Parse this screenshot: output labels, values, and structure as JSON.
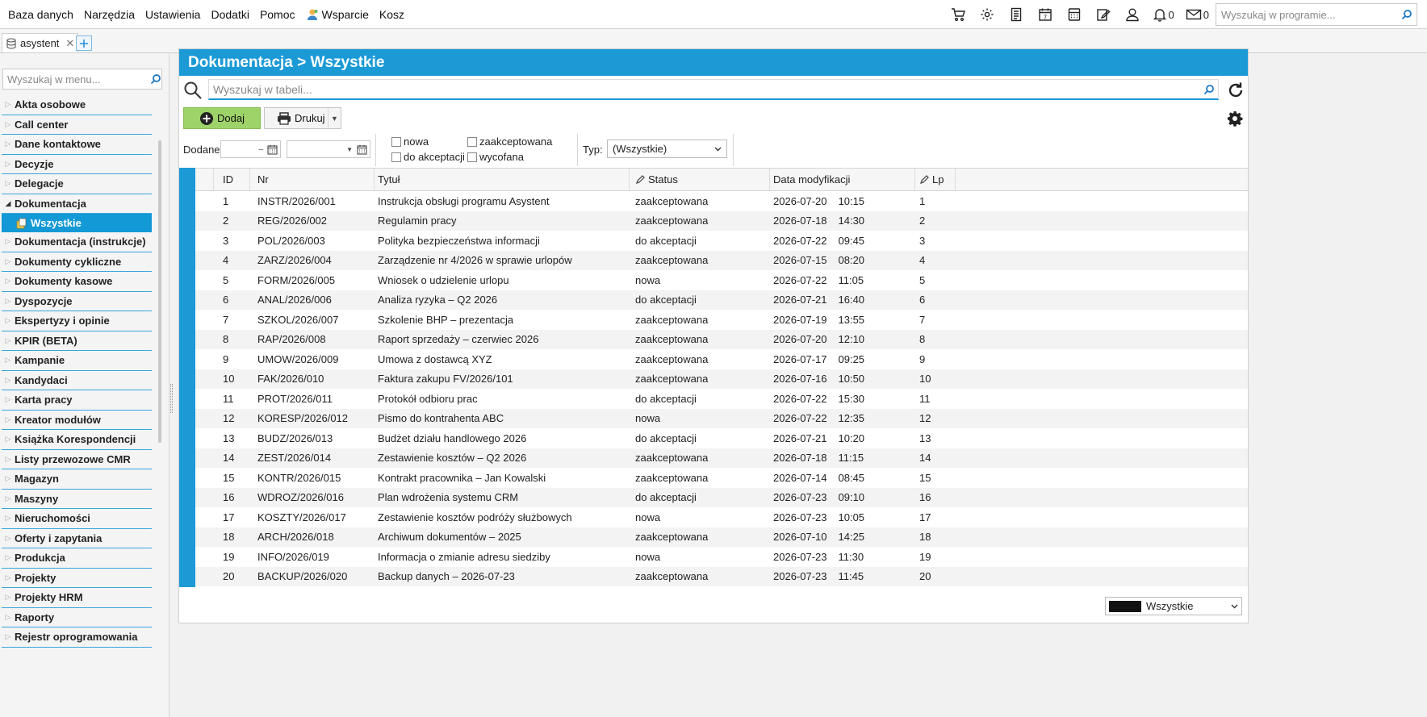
{
  "menu": {
    "items": [
      "Baza danych",
      "Narzędzia",
      "Ustawienia",
      "Dodatki",
      "Pomoc"
    ],
    "support_label": "Wsparcie",
    "cart_label": "Kosz"
  },
  "top_icons": {
    "names": [
      "cart-icon",
      "gear-icon",
      "document-icon",
      "calendar-icon",
      "calculator-icon",
      "edit-icon",
      "user-icon",
      "bell-icon",
      "mail-icon"
    ],
    "bell_count": "0",
    "mail_count": "0"
  },
  "top_search": {
    "placeholder": "Wyszukaj w programie..."
  },
  "tabs": {
    "active_label": "asystent",
    "close_symbol": "✕"
  },
  "sidebar": {
    "search_placeholder": "Wyszukaj w menu...",
    "items_before": [
      "Akta osobowe",
      "Call center",
      "Dane kontaktowe",
      "Decyzje",
      "Delegacje"
    ],
    "open_item": "Dokumentacja",
    "open_sub": "Wszystkie",
    "items_after": [
      "Dokumentacja (instrukcje)",
      "Dokumenty cykliczne",
      "Dokumenty kasowe",
      "Dyspozycje",
      "Ekspertyzy i opinie",
      "KPIR (BETA)",
      "Kampanie",
      "Kandydaci",
      "Karta pracy",
      "Kreator modułów",
      "Książka Korespondencji",
      "Listy przewozowe CMR",
      "Magazyn",
      "Maszyny",
      "Nieruchomości",
      "Oferty i zapytania",
      "Produkcja",
      "Projekty",
      "Projekty HRM",
      "Raporty",
      "Rejestr oprogramowania"
    ]
  },
  "main": {
    "title": "Dokumentacja > Wszystkie",
    "table_search_placeholder": "Wyszukaj w tabeli...",
    "add_label": "Dodaj",
    "print_label": "Drukuj",
    "filters": {
      "added_label": "Dodane:",
      "checkboxes": [
        "nowa",
        "zaakceptowana",
        "do akceptacji",
        "wycofana"
      ],
      "type_label": "Typ:",
      "type_value": "(Wszystkie)"
    },
    "columns": [
      "ID",
      "Nr",
      "Tytuł",
      "Status",
      "Data modyfikacji",
      "Lp"
    ],
    "rows": [
      {
        "id": "1",
        "nr": "INSTR/2026/001",
        "title": "Instrukcja obsługi programu Asystent",
        "status": "zaakceptowana",
        "date": "2026-07-20",
        "time": "10:15",
        "lp": "1"
      },
      {
        "id": "2",
        "nr": "REG/2026/002",
        "title": "Regulamin pracy",
        "status": "zaakceptowana",
        "date": "2026-07-18",
        "time": "14:30",
        "lp": "2"
      },
      {
        "id": "3",
        "nr": "POL/2026/003",
        "title": "Polityka bezpieczeństwa informacji",
        "status": "do akceptacji",
        "date": "2026-07-22",
        "time": "09:45",
        "lp": "3"
      },
      {
        "id": "4",
        "nr": "ZARZ/2026/004",
        "title": "Zarządzenie nr 4/2026 w sprawie urlopów",
        "status": "zaakceptowana",
        "date": "2026-07-15",
        "time": "08:20",
        "lp": "4"
      },
      {
        "id": "5",
        "nr": "FORM/2026/005",
        "title": "Wniosek o udzielenie urlopu",
        "status": "nowa",
        "date": "2026-07-22",
        "time": "11:05",
        "lp": "5"
      },
      {
        "id": "6",
        "nr": "ANAL/2026/006",
        "title": "Analiza ryzyka – Q2 2026",
        "status": "do akceptacji",
        "date": "2026-07-21",
        "time": "16:40",
        "lp": "6"
      },
      {
        "id": "7",
        "nr": "SZKOL/2026/007",
        "title": "Szkolenie BHP – prezentacja",
        "status": "zaakceptowana",
        "date": "2026-07-19",
        "time": "13:55",
        "lp": "7"
      },
      {
        "id": "8",
        "nr": "RAP/2026/008",
        "title": "Raport sprzedaży – czerwiec 2026",
        "status": "zaakceptowana",
        "date": "2026-07-20",
        "time": "12:10",
        "lp": "8"
      },
      {
        "id": "9",
        "nr": "UMOW/2026/009",
        "title": "Umowa z dostawcą XYZ",
        "status": "zaakceptowana",
        "date": "2026-07-17",
        "time": "09:25",
        "lp": "9"
      },
      {
        "id": "10",
        "nr": "FAK/2026/010",
        "title": "Faktura zakupu FV/2026/101",
        "status": "zaakceptowana",
        "date": "2026-07-16",
        "time": "10:50",
        "lp": "10"
      },
      {
        "id": "11",
        "nr": "PROT/2026/011",
        "title": "Protokół odbioru prac",
        "status": "do akceptacji",
        "date": "2026-07-22",
        "time": "15:30",
        "lp": "11"
      },
      {
        "id": "12",
        "nr": "KORESP/2026/012",
        "title": "Pismo do kontrahenta ABC",
        "status": "nowa",
        "date": "2026-07-22",
        "time": "12:35",
        "lp": "12"
      },
      {
        "id": "13",
        "nr": "BUDZ/2026/013",
        "title": "Budżet działu handlowego 2026",
        "status": "do akceptacji",
        "date": "2026-07-21",
        "time": "10:20",
        "lp": "13"
      },
      {
        "id": "14",
        "nr": "ZEST/2026/014",
        "title": "Zestawienie kosztów – Q2 2026",
        "status": "zaakceptowana",
        "date": "2026-07-18",
        "time": "11:15",
        "lp": "14"
      },
      {
        "id": "15",
        "nr": "KONTR/2026/015",
        "title": "Kontrakt pracownika – Jan Kowalski",
        "status": "zaakceptowana",
        "date": "2026-07-14",
        "time": "08:45",
        "lp": "15"
      },
      {
        "id": "16",
        "nr": "WDROZ/2026/016",
        "title": "Plan wdrożenia systemu CRM",
        "status": "do akceptacji",
        "date": "2026-07-23",
        "time": "09:10",
        "lp": "16"
      },
      {
        "id": "17",
        "nr": "KOSZTY/2026/017",
        "title": "Zestawienie kosztów podróży służbowych",
        "status": "nowa",
        "date": "2026-07-23",
        "time": "10:05",
        "lp": "17"
      },
      {
        "id": "18",
        "nr": "ARCH/2026/018",
        "title": "Archiwum dokumentów – 2025",
        "status": "zaakceptowana",
        "date": "2026-07-10",
        "time": "14:25",
        "lp": "18"
      },
      {
        "id": "19",
        "nr": "INFO/2026/019",
        "title": "Informacja o zmianie adresu siedziby",
        "status": "nowa",
        "date": "2026-07-23",
        "time": "11:30",
        "lp": "19"
      },
      {
        "id": "20",
        "nr": "BACKUP/2026/020",
        "title": "Backup danych – 2026-07-23",
        "status": "zaakceptowana",
        "date": "2026-07-23",
        "time": "11:45",
        "lp": "20"
      }
    ],
    "footer_select": "Wszystkie"
  },
  "colors": {
    "accent": "#1b9ad6",
    "add_button": "#9ed36a"
  }
}
